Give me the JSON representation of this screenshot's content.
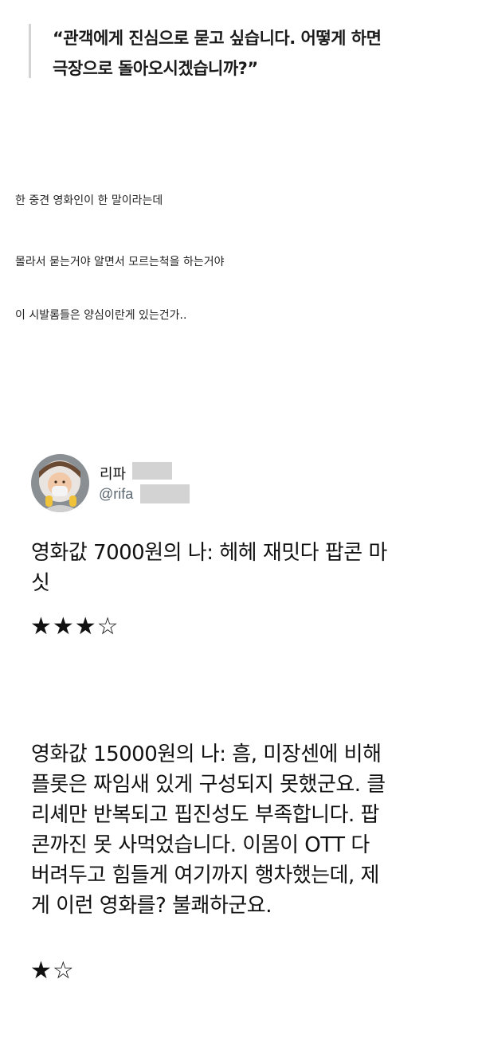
{
  "quote": {
    "line1": "“관객에게 진심으로 묻고 싶습니다. 어떻게 하면",
    "line2": "극장으로 돌아오시겠습니까?”"
  },
  "post": {
    "line1": "한 중견 영화인이 한 말이라는데",
    "line2": "몰라서 묻는거야 알면서 모르는척을 하는거야",
    "line3": "이 시발롬들은 양심이란게 있는건가.."
  },
  "tweet": {
    "display_name": "리파",
    "handle": "@rifa",
    "review1": {
      "lines": [
        "영화값 7000원의 나: 헤헤 재밋다 팝콘 마",
        "싯"
      ],
      "stars": "★★★☆"
    },
    "review2": {
      "lines": [
        "영화값 15000원의 나: 흠, 미장센에 비해",
        "플롯은 짜임새 있게 구성되지 못했군요. 클",
        "리셰만 반복되고 핍진성도 부족합니다. 팝",
        "콘까진 못 사먹었습니다. 이몸이 OTT 다",
        "버려두고 힘들게 여기까지 행차했는데, 제",
        "게 이런 영화를? 불쾌하군요."
      ],
      "stars": "★☆"
    }
  }
}
